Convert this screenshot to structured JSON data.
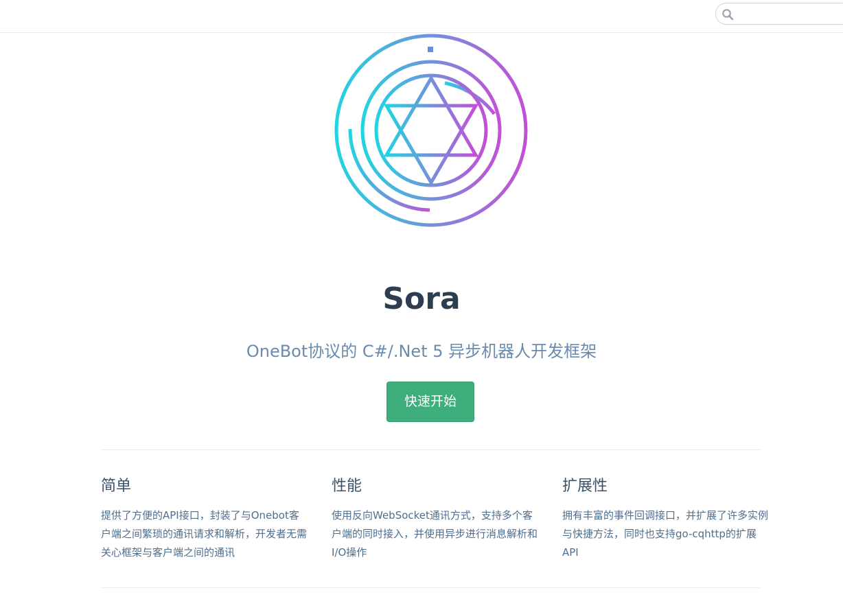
{
  "search": {
    "placeholder": "",
    "icon": "search-icon"
  },
  "hero": {
    "logo": "sora-logo",
    "title": "Sora",
    "description": "OneBot协议的 C#/.Net 5 异步机器人开发框架",
    "action_label": "快速开始",
    "colors": {
      "gradient_start": "#22d3e0",
      "gradient_end": "#c44fd6",
      "button": "#3eaf7c"
    }
  },
  "features": [
    {
      "title": "简单",
      "details": "提供了方便的API接口，封装了与Onebot客户端之间繁琐的通讯请求和解析，开发者无需关心框架与客户端之间的通讯"
    },
    {
      "title": "性能",
      "details": "使用反向WebSocket通讯方式，支持多个客户端的同时接入，并使用异步进行消息解析和I/O操作"
    },
    {
      "title": "扩展性",
      "details": "拥有丰富的事件回调接口，并扩展了许多实例与快捷方法，同时也支持go-cqhttp的扩展API"
    }
  ]
}
